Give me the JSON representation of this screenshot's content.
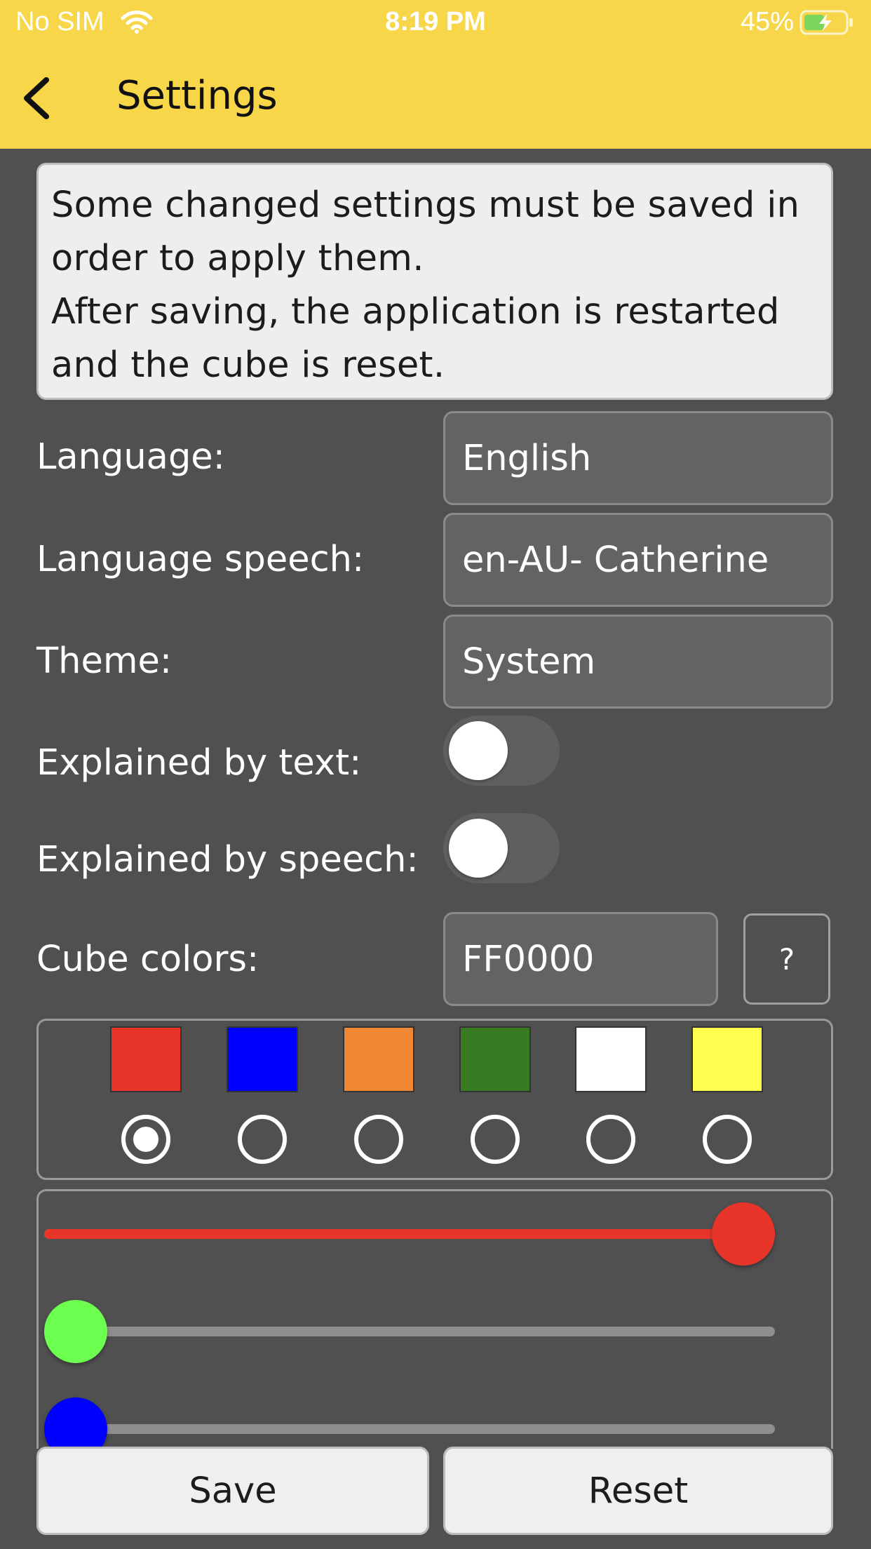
{
  "status_bar": {
    "carrier": "No SIM",
    "time": "8:19 PM",
    "battery_percent": "45%"
  },
  "header": {
    "title": "Settings",
    "background_color": "#F8D64A"
  },
  "info": {
    "lines": [
      "Some changed settings must be saved in",
      "order to apply them.",
      "After saving, the application is restarted",
      "and the cube is reset."
    ]
  },
  "settings": {
    "language": {
      "label": "Language:",
      "value": "English"
    },
    "language_speech": {
      "label": "Language speech:",
      "value": "en-AU- Catherine"
    },
    "theme": {
      "label": "Theme:",
      "value": "System"
    },
    "explained_by_text": {
      "label": "Explained by text:",
      "on": false
    },
    "explained_by_speech": {
      "label": "Explained by speech:",
      "on": false
    },
    "cube_colors": {
      "label": "Cube colors:",
      "value": "FF0000",
      "help_label": "?"
    }
  },
  "palette": {
    "selected_index": 0,
    "swatches": [
      "#E8352A",
      "#0000FF",
      "#EF8733",
      "#367A22",
      "#FFFFFF",
      "#FFFF4F"
    ]
  },
  "sliders": [
    {
      "name": "red",
      "color": "#E8352A",
      "level": 1.0
    },
    {
      "name": "green",
      "color": "#6CFF4F",
      "level": 0.0
    },
    {
      "name": "blue",
      "color": "#0000FF",
      "level": 0.0
    }
  ],
  "buttons": {
    "save": "Save",
    "reset": "Reset"
  }
}
